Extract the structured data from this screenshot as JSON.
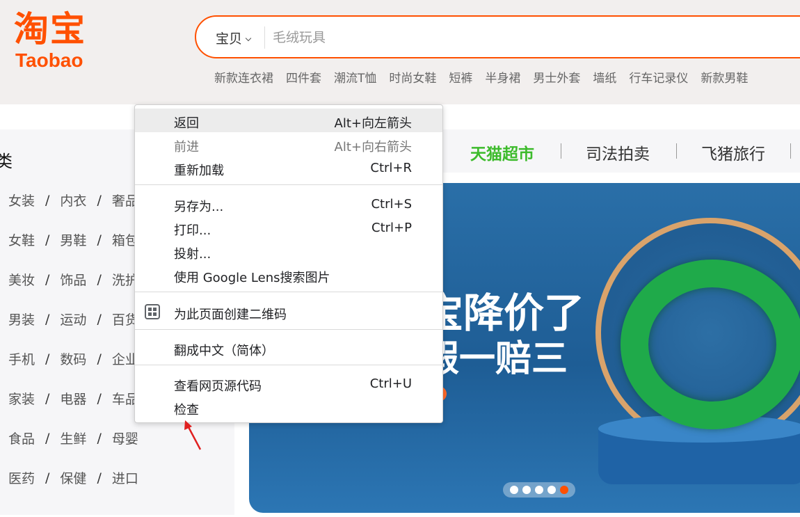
{
  "logo": {
    "cn": "淘宝",
    "en": "Taobao"
  },
  "search": {
    "type": "宝贝",
    "placeholder": "毛绒玩具"
  },
  "hot_words": [
    "新款连衣裙",
    "四件套",
    "潮流T恤",
    "时尚女鞋",
    "短裤",
    "半身裙",
    "男士外套",
    "墙纸",
    "行车记录仪",
    "新款男鞋"
  ],
  "categories": {
    "title": "类",
    "rows": [
      [
        "女装",
        "内衣",
        "奢品"
      ],
      [
        "女鞋",
        "男鞋",
        "箱包"
      ],
      [
        "美妆",
        "饰品",
        "洗护"
      ],
      [
        "男装",
        "运动",
        "百货"
      ],
      [
        "手机",
        "数码",
        "企业"
      ],
      [
        "家装",
        "电器",
        "车品"
      ],
      [
        "食品",
        "生鲜",
        "母婴"
      ],
      [
        "医药",
        "保健",
        "进口"
      ]
    ],
    "separator": "/"
  },
  "nav": {
    "tmall_market": "天猫超市",
    "auction": "司法拍卖",
    "fliggy": "飞猪旅行"
  },
  "banner": {
    "line1": "宝降价了",
    "line2": "假一赔三"
  },
  "context_menu": {
    "back": {
      "label": "返回",
      "shortcut": "Alt+向左箭头"
    },
    "forward": {
      "label": "前进",
      "shortcut": "Alt+向右箭头"
    },
    "reload": {
      "label": "重新加载",
      "shortcut": "Ctrl+R"
    },
    "save_as": {
      "label": "另存为...",
      "shortcut": "Ctrl+S"
    },
    "print": {
      "label": "打印...",
      "shortcut": "Ctrl+P"
    },
    "cast": {
      "label": "投射..."
    },
    "lens": {
      "label": "使用 Google Lens搜索图片"
    },
    "qr": {
      "label": "为此页面创建二维码"
    },
    "translate": {
      "label": "翻成中文（简体）"
    },
    "view_source": {
      "label": "查看网页源代码",
      "shortcut": "Ctrl+U"
    },
    "inspect": {
      "label": "检查"
    }
  },
  "colors": {
    "brand": "#ff5000",
    "tmall_green": "#3dbb2c",
    "arrow": "#e02020"
  }
}
